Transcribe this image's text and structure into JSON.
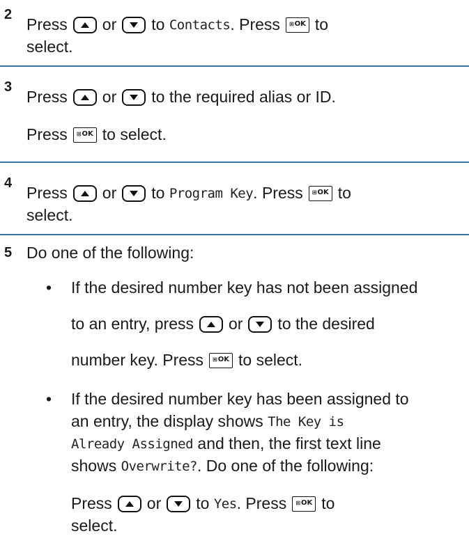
{
  "steps": {
    "s2": {
      "num": "2",
      "press": "Press",
      "or": "or",
      "to": "to",
      "target": "Contacts",
      "press2": ". Press",
      "to_select": "to",
      "select": "select."
    },
    "s3": {
      "num": "3",
      "press": "Press",
      "or": "or",
      "rest": "to the required alias or ID.",
      "press2": "Press",
      "to_select": "to select."
    },
    "s4": {
      "num": "4",
      "press": "Press",
      "or": "or",
      "to": "to",
      "target": "Program Key",
      "press2": ". Press",
      "to_select": "to",
      "select": "select."
    },
    "s5": {
      "num": "5",
      "intro": "Do one of the following:",
      "bullet": "•",
      "b1_line1": "If the desired number key has not been assigned",
      "b1_line2_a": "to an entry, press",
      "b1_or": "or",
      "b1_line2_b": "to the desired",
      "b1_line3_a": "number key. Press",
      "b1_line3_b": "to select.",
      "b2_line1": "If the desired number key has been assigned to",
      "b2_line2_a": "an entry, the display shows",
      "b2_line2_mono": "The Key is",
      "b2_line3_mono": "Already Assigned",
      "b2_line3_b": "and then, the first text line",
      "b2_line4_a": "shows",
      "b2_line4_mono": "Overwrite?",
      "b2_line4_b": ". Do one of the following:",
      "sub_press": "Press",
      "sub_or": "or",
      "sub_to": "to",
      "sub_target": "Yes",
      "sub_press2": ". Press",
      "sub_to2": "to",
      "sub_select": "select."
    }
  },
  "ok_label": "OK",
  "ok_grid": "⊞",
  "icons": {
    "up": "up-arrow-icon",
    "down": "down-arrow-icon"
  },
  "colors": {
    "divider": "#2f74b5"
  }
}
